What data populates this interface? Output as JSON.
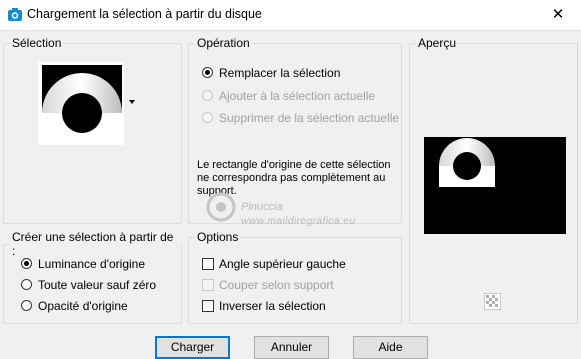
{
  "window": {
    "title": "Chargement la sélection à partir du disque",
    "close_symbol": "✕"
  },
  "selection": {
    "legend": "Sélection",
    "dropdown_icon": "triangle-down"
  },
  "operation": {
    "legend": "Opération",
    "options": [
      {
        "label": "Remplacer la sélection",
        "checked": true,
        "enabled": true
      },
      {
        "label": "Ajouter à la sélection actuelle",
        "checked": false,
        "enabled": false
      },
      {
        "label": "Supprimer de la sélection actuelle",
        "checked": false,
        "enabled": false
      }
    ],
    "info": "Le rectangle d'origine de cette sélection ne correspondra pas complètement au support."
  },
  "preview": {
    "legend": "Aperçu"
  },
  "create_from": {
    "legend": "Créer une sélection à partir de :",
    "options": [
      {
        "label": "Luminance d'origine",
        "checked": true
      },
      {
        "label": "Toute valeur sauf zéro",
        "checked": false
      },
      {
        "label": "Opacité d'origine",
        "checked": false
      }
    ]
  },
  "options": {
    "legend": "Options",
    "items": [
      {
        "label": "Angle supérieur gauche",
        "checked": false,
        "enabled": true
      },
      {
        "label": "Couper selon support",
        "checked": false,
        "enabled": false
      },
      {
        "label": "Inverser la sélection",
        "checked": false,
        "enabled": true
      }
    ]
  },
  "watermark": {
    "name": "Pinuccia",
    "url": "www.maildiregrafica.eu"
  },
  "buttons": {
    "ok": "Charger",
    "cancel": "Annuler",
    "help": "Aide"
  }
}
